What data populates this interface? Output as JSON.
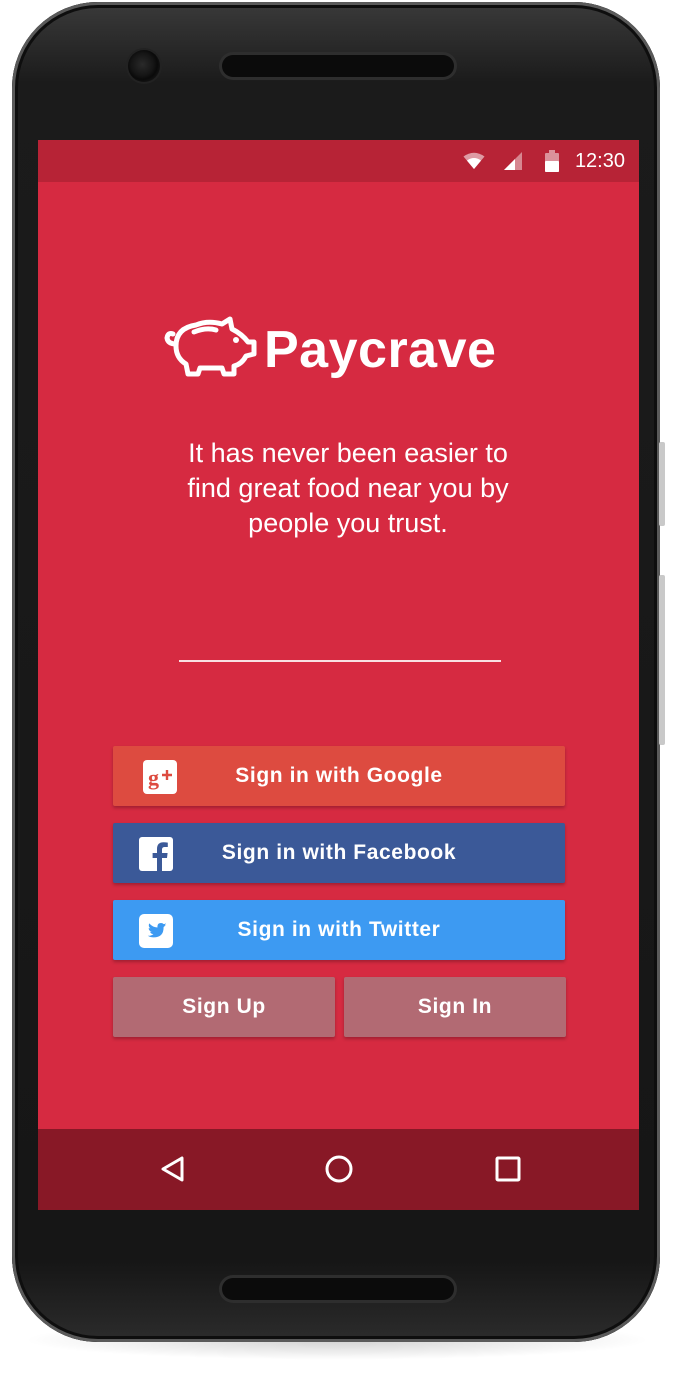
{
  "status_bar": {
    "time": "12:30"
  },
  "app": {
    "name": "Paycrave",
    "tagline": "It has never been easier to find great food near you by people you trust."
  },
  "buttons": {
    "google": "Sign in with Google",
    "facebook": "Sign in with Facebook",
    "twitter": "Sign in with Twitter",
    "sign_up": "Sign Up",
    "sign_in": "Sign In"
  },
  "icons": {
    "google": "google-plus-icon",
    "facebook": "facebook-icon",
    "twitter": "twitter-icon",
    "logo": "piggy-bank-icon",
    "nav": [
      "back-icon",
      "home-icon",
      "recents-icon"
    ]
  },
  "colors": {
    "background": "#d62a41",
    "status_bar": "#b72336",
    "nav_bar": "#881826",
    "google": "#dd4b40",
    "facebook": "#3b5998",
    "twitter": "#3d9af2",
    "secondary_button": "#b26a73"
  }
}
